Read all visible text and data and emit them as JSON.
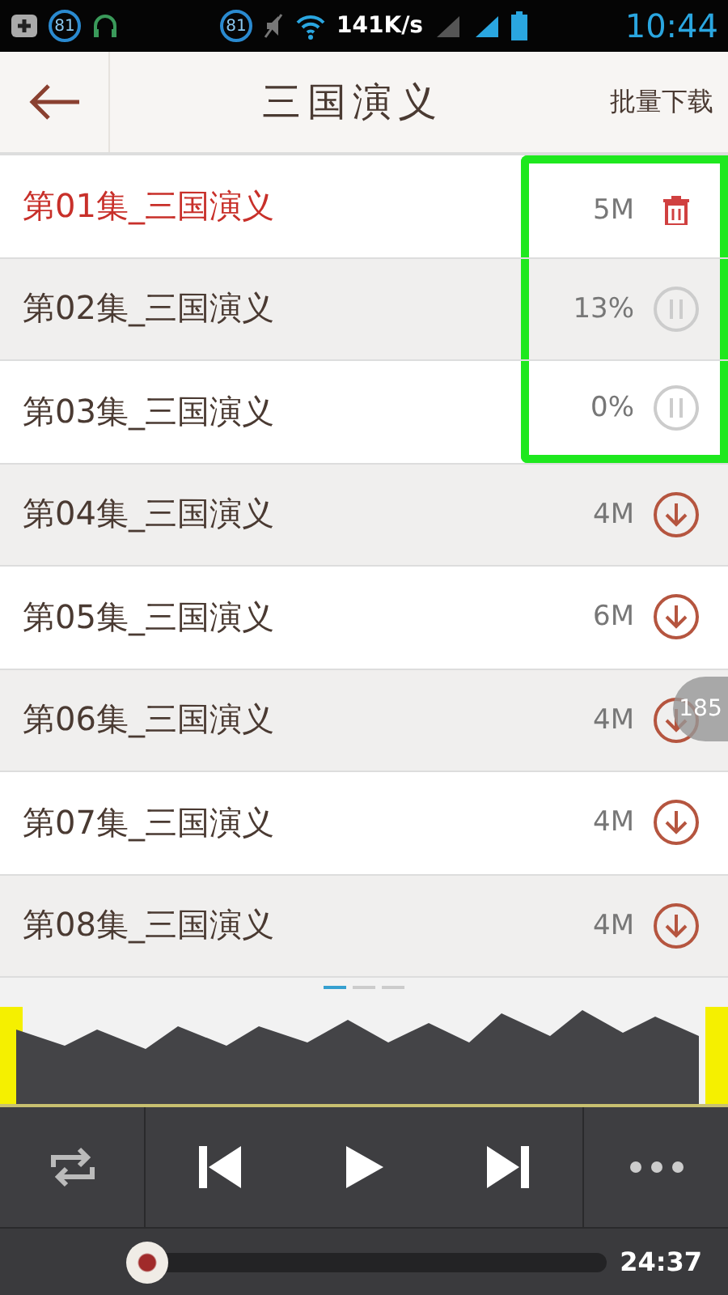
{
  "status_bar": {
    "badges": [
      "81",
      "81"
    ],
    "speed": "141K/s",
    "time": "10:44"
  },
  "header": {
    "title": "三国演义",
    "action": "批量下载"
  },
  "episodes": [
    {
      "title": "第01集_三国演义",
      "kind": "downloaded",
      "size": "5M",
      "playing": true,
      "highlighted": true
    },
    {
      "title": "第02集_三国演义",
      "kind": "downloading",
      "size": "13%",
      "playing": false,
      "highlighted": true
    },
    {
      "title": "第03集_三国演义",
      "kind": "downloading",
      "size": "0%",
      "playing": false,
      "highlighted": true
    },
    {
      "title": "第04集_三国演义",
      "kind": "available",
      "size": "4M",
      "playing": false,
      "highlighted": false
    },
    {
      "title": "第05集_三国演义",
      "kind": "available",
      "size": "6M",
      "playing": false,
      "highlighted": false
    },
    {
      "title": "第06集_三国演义",
      "kind": "available",
      "size": "4M",
      "playing": false,
      "highlighted": false
    },
    {
      "title": "第07集_三国演义",
      "kind": "available",
      "size": "4M",
      "playing": false,
      "highlighted": false
    },
    {
      "title": "第08集_三国演义",
      "kind": "available",
      "size": "4M",
      "playing": false,
      "highlighted": false
    }
  ],
  "floating_badge": "185",
  "pages": [
    {
      "selected": true
    },
    {
      "selected": false
    },
    {
      "selected": false
    }
  ],
  "player": {
    "level": 0.0,
    "time": "24:37"
  }
}
